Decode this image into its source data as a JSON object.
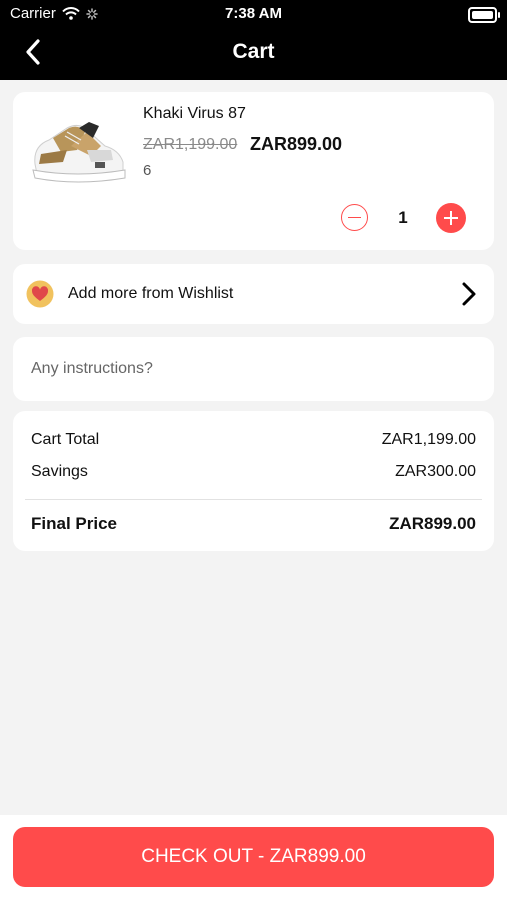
{
  "status_bar": {
    "carrier": "Carrier",
    "time": "7:38 AM"
  },
  "nav": {
    "title": "Cart"
  },
  "cart_item": {
    "name": "Khaki Virus 87",
    "original_price": "ZAR1,199.00",
    "price": "ZAR899.00",
    "size": "6",
    "quantity": "1"
  },
  "wishlist": {
    "label": "Add more from Wishlist"
  },
  "instructions": {
    "placeholder": "Any instructions?"
  },
  "summary": {
    "cart_total_label": "Cart Total",
    "cart_total_value": "ZAR1,199.00",
    "savings_label": "Savings",
    "savings_value": "ZAR300.00",
    "final_label": "Final Price",
    "final_value": "ZAR899.00"
  },
  "checkout": {
    "label": "CHECK OUT - ZAR899.00"
  },
  "colors": {
    "accent": "#ff4b4b",
    "header": "#000000",
    "background": "#f3f3f3"
  }
}
